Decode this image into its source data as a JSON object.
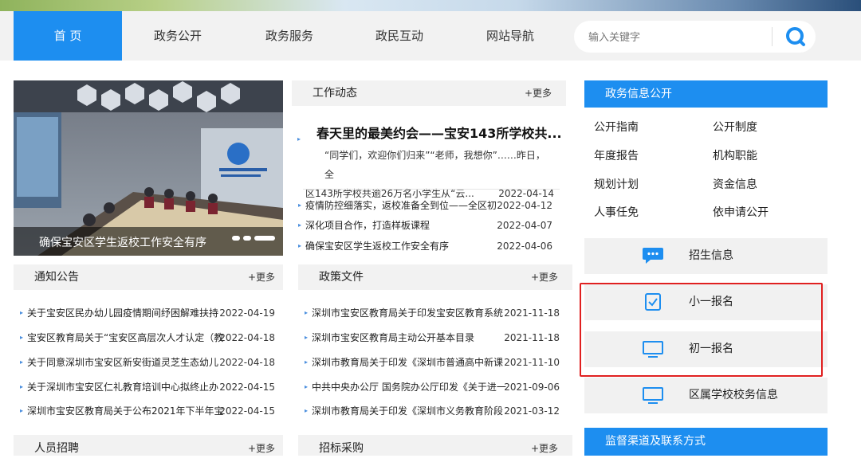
{
  "nav": {
    "items": [
      "首 页",
      "政务公开",
      "政务服务",
      "政民互动",
      "网站导航"
    ],
    "active": 0
  },
  "search": {
    "placeholder": "输入关键字",
    "icon": "search-icon"
  },
  "slideshow": {
    "caption": "确保宝安区学生返校工作安全有序",
    "slides": 3,
    "active": 2
  },
  "work_news": {
    "title": "工作动态",
    "more": "+更多",
    "featured": {
      "title": "春天里的最美约会——宝安143所学校共...",
      "summary_line1": "“同学们，欢迎你们归来”“老师，我想你”……昨日，全",
      "summary_line2": "区143所学校共逾26万名小学生从“云...",
      "date": "2022-04-14"
    },
    "items": [
      {
        "title": "疫情防控细落实，返校准备全到位——全区初",
        "date": "2022-04-12"
      },
      {
        "title": "深化项目合作，打造样板课程",
        "date": "2022-04-07"
      },
      {
        "title": "确保宝安区学生返校工作安全有序",
        "date": "2022-04-06"
      }
    ]
  },
  "notices": {
    "title": "通知公告",
    "more": "+更多",
    "items": [
      {
        "title": "关于宝安区民办幼儿园疫情期间纾困解难扶持",
        "date": "2022-04-19"
      },
      {
        "title": "宝安区教育局关于“宝安区高层次人才认定（教",
        "date": "2022-04-18"
      },
      {
        "title": "关于同意深圳市宝安区新安街道灵芝生态幼儿",
        "date": "2022-04-18"
      },
      {
        "title": "关于深圳市宝安区仁礼教育培训中心拟终止办",
        "date": "2022-04-15"
      },
      {
        "title": "深圳市宝安区教育局关于公布2021年下半年宝",
        "date": "2022-04-15"
      }
    ]
  },
  "policies": {
    "title": "政策文件",
    "more": "+更多",
    "items": [
      {
        "title": "深圳市宝安区教育局关于印发宝安区教育系统",
        "date": "2021-11-18"
      },
      {
        "title": "深圳市宝安区教育局主动公开基本目录",
        "date": "2021-11-18"
      },
      {
        "title": "深圳市教育局关于印发《深圳市普通高中新课",
        "date": "2021-11-10"
      },
      {
        "title": "中共中央办公厅 国务院办公厅印发《关于进一",
        "date": "2021-09-06"
      },
      {
        "title": "深圳市教育局关于印发《深圳市义务教育阶段",
        "date": "2021-03-12"
      }
    ]
  },
  "recruit": {
    "title": "人员招聘",
    "more": "+更多"
  },
  "bidding": {
    "title": "招标采购",
    "more": "+更多"
  },
  "gov_info": {
    "title": "政务信息公开",
    "items": [
      "公开指南",
      "公开制度",
      "年度报告",
      "机构职能",
      "规划计划",
      "资金信息",
      "人事任免",
      "依申请公开"
    ]
  },
  "services": [
    {
      "label": "招生信息",
      "icon": "chat-bubble-icon"
    },
    {
      "label": "小一报名",
      "icon": "checklist-icon"
    },
    {
      "label": "初一报名",
      "icon": "monitor-icon"
    },
    {
      "label": "区属学校校务信息",
      "icon": "monitor-icon"
    }
  ],
  "supervision": {
    "title": "监督渠道及联系方式"
  },
  "colors": {
    "accent": "#1d8ef0",
    "highlight_border": "#e02020",
    "panel_bg": "#f2f2f2"
  }
}
